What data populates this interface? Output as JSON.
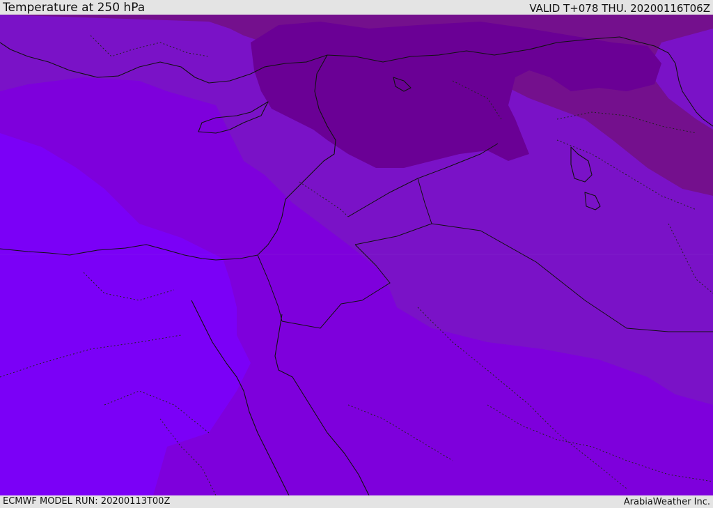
{
  "header": {
    "title": "Temperature at 250 hPa",
    "valid": "VALID T+078 THU. 20200116T06Z"
  },
  "footer": {
    "model_run": "ECMWF MODEL RUN: 20200113T00Z",
    "credit": "ArabiaWeather Inc."
  },
  "map": {
    "type": "temperature-contour-map",
    "field_colors": {
      "warmest": "#7b00f7",
      "mid_1": "#7e00dc",
      "mid_2": "#7a12c7",
      "mid_3": "#74108d",
      "coolest": "#6a0095",
      "coast_color": "#111111"
    }
  }
}
